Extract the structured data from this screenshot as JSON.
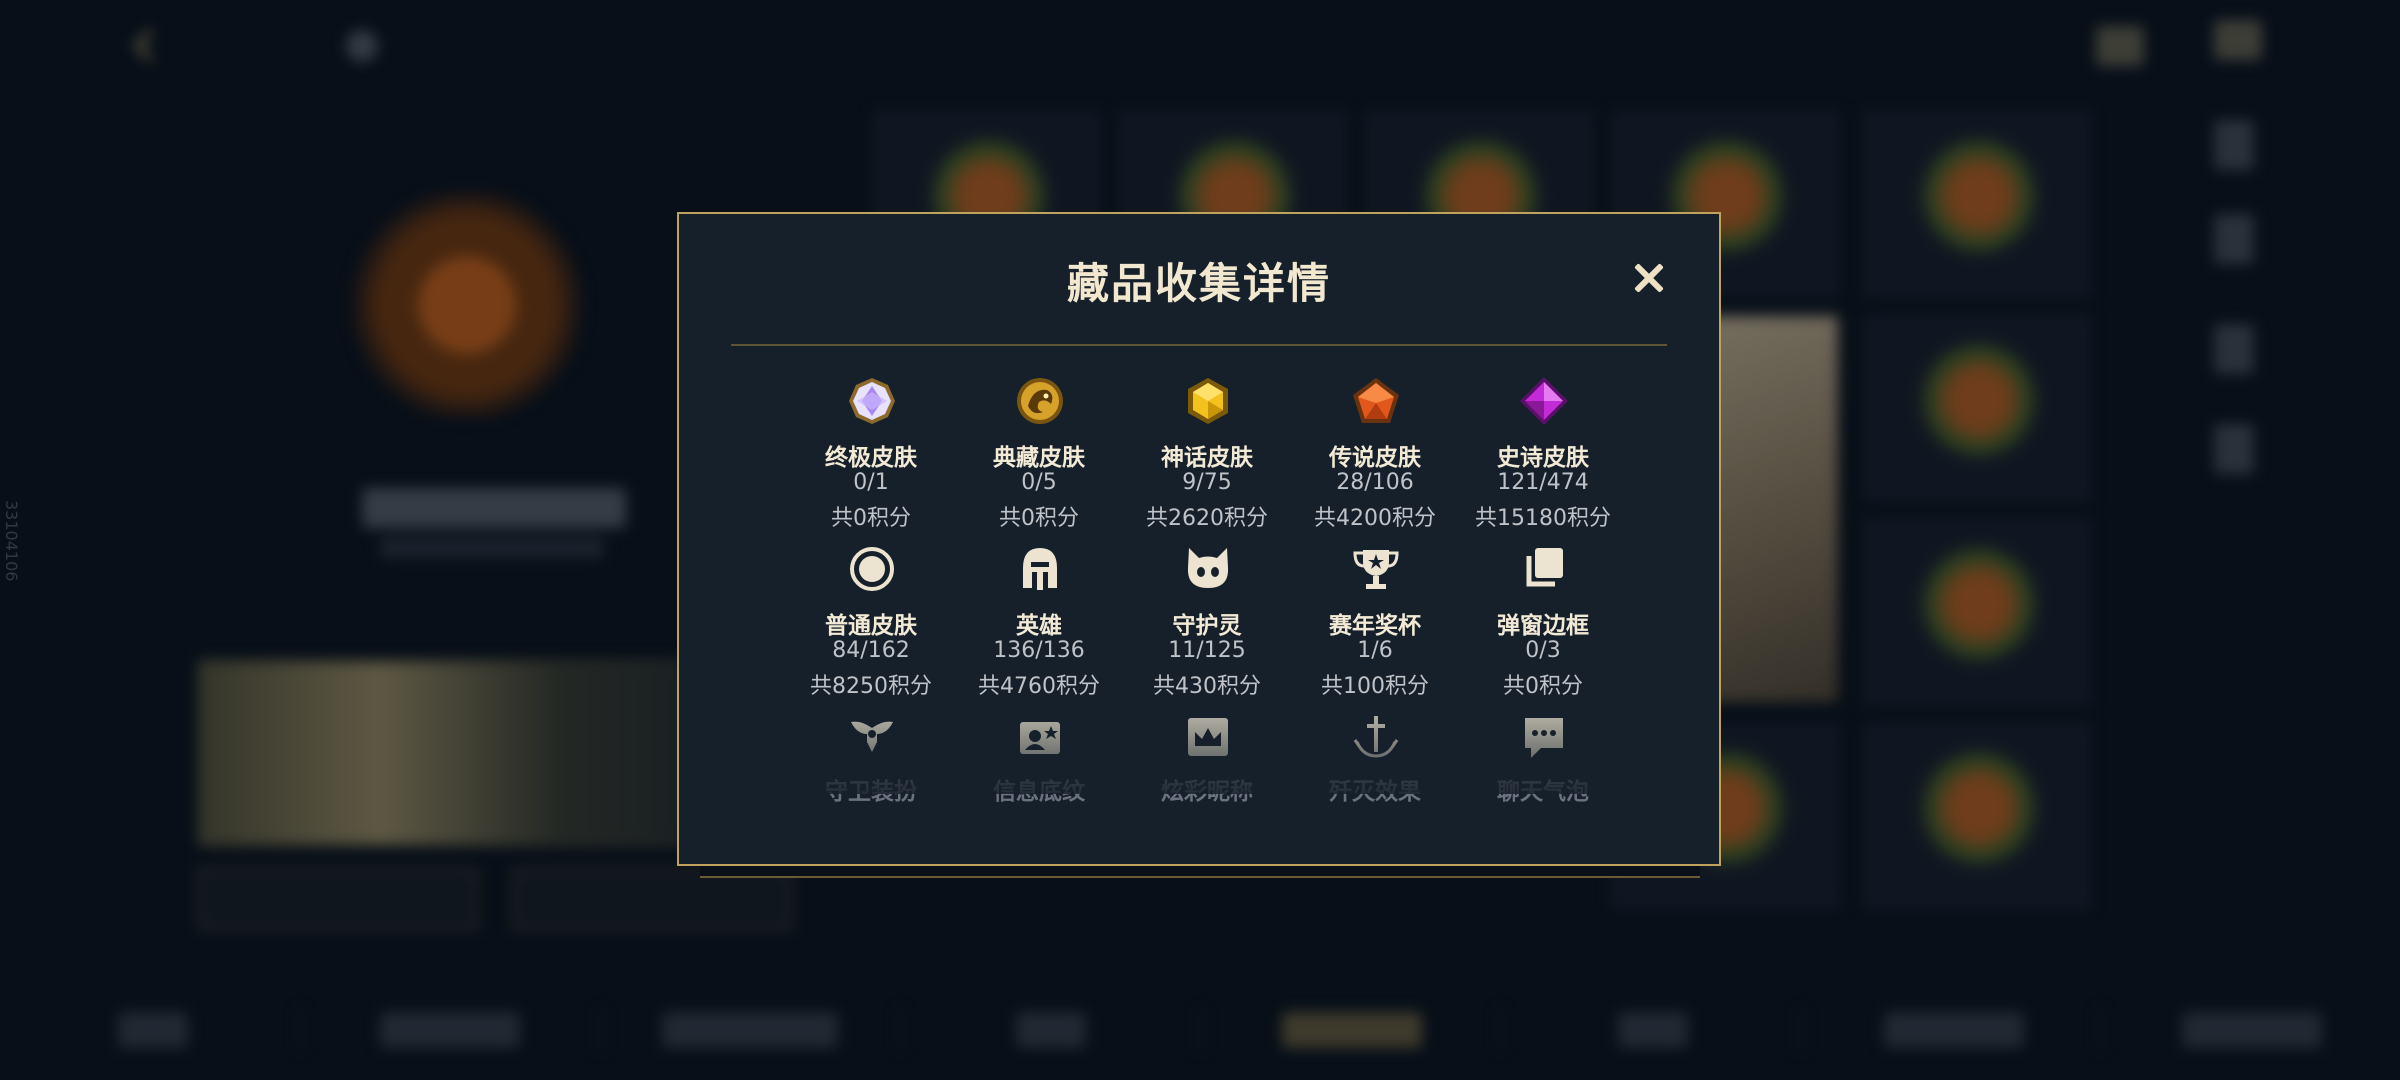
{
  "background": {
    "version": "33104106"
  },
  "dialog": {
    "title": "藏品收集详情",
    "close_icon": "close-icon",
    "items": [
      {
        "name": "终极皮肤",
        "count": "0/1",
        "points": "共0积分",
        "icon": "ultimate-skin-gem-icon",
        "color": "#b49cf0"
      },
      {
        "name": "典藏皮肤",
        "count": "0/5",
        "points": "共0积分",
        "icon": "prestige-skin-emblem-icon",
        "color": "#d6a22a"
      },
      {
        "name": "神话皮肤",
        "count": "9/75",
        "points": "共2620积分",
        "icon": "mythic-skin-gem-icon",
        "color": "#f0c020"
      },
      {
        "name": "传说皮肤",
        "count": "28/106",
        "points": "共4200积分",
        "icon": "legendary-skin-gem-icon",
        "color": "#e2571c"
      },
      {
        "name": "史诗皮肤",
        "count": "121/474",
        "points": "共15180积分",
        "icon": "epic-skin-gem-icon",
        "color": "#c22bd6"
      },
      {
        "name": "普通皮肤",
        "count": "84/162",
        "points": "共8250积分",
        "icon": "standard-skin-circle-icon",
        "color": "#e8e0cc"
      },
      {
        "name": "英雄",
        "count": "136/136",
        "points": "共4760积分",
        "icon": "champion-helmet-icon",
        "color": "#e8e0cc"
      },
      {
        "name": "守护灵",
        "count": "11/125",
        "points": "共430积分",
        "icon": "little-legend-icon",
        "color": "#e8e0cc"
      },
      {
        "name": "赛年奖杯",
        "count": "1/6",
        "points": "共100积分",
        "icon": "trophy-icon",
        "color": "#e8e0cc"
      },
      {
        "name": "弹窗边框",
        "count": "0/3",
        "points": "共0积分",
        "icon": "border-frames-icon",
        "color": "#e8e0cc"
      },
      {
        "name": "守卫装扮",
        "icon": "ward-skin-icon",
        "color": "#e8e0cc"
      },
      {
        "name": "信息底纹",
        "icon": "banner-pattern-icon",
        "color": "#e8e0cc"
      },
      {
        "name": "炫彩昵称",
        "icon": "nameplate-crown-icon",
        "color": "#e8e0cc"
      },
      {
        "name": "歼灭效果",
        "icon": "finisher-sword-icon",
        "color": "#e8e0cc"
      },
      {
        "name": "聊天气泡",
        "icon": "chat-bubble-icon",
        "color": "#e8e0cc"
      }
    ]
  }
}
